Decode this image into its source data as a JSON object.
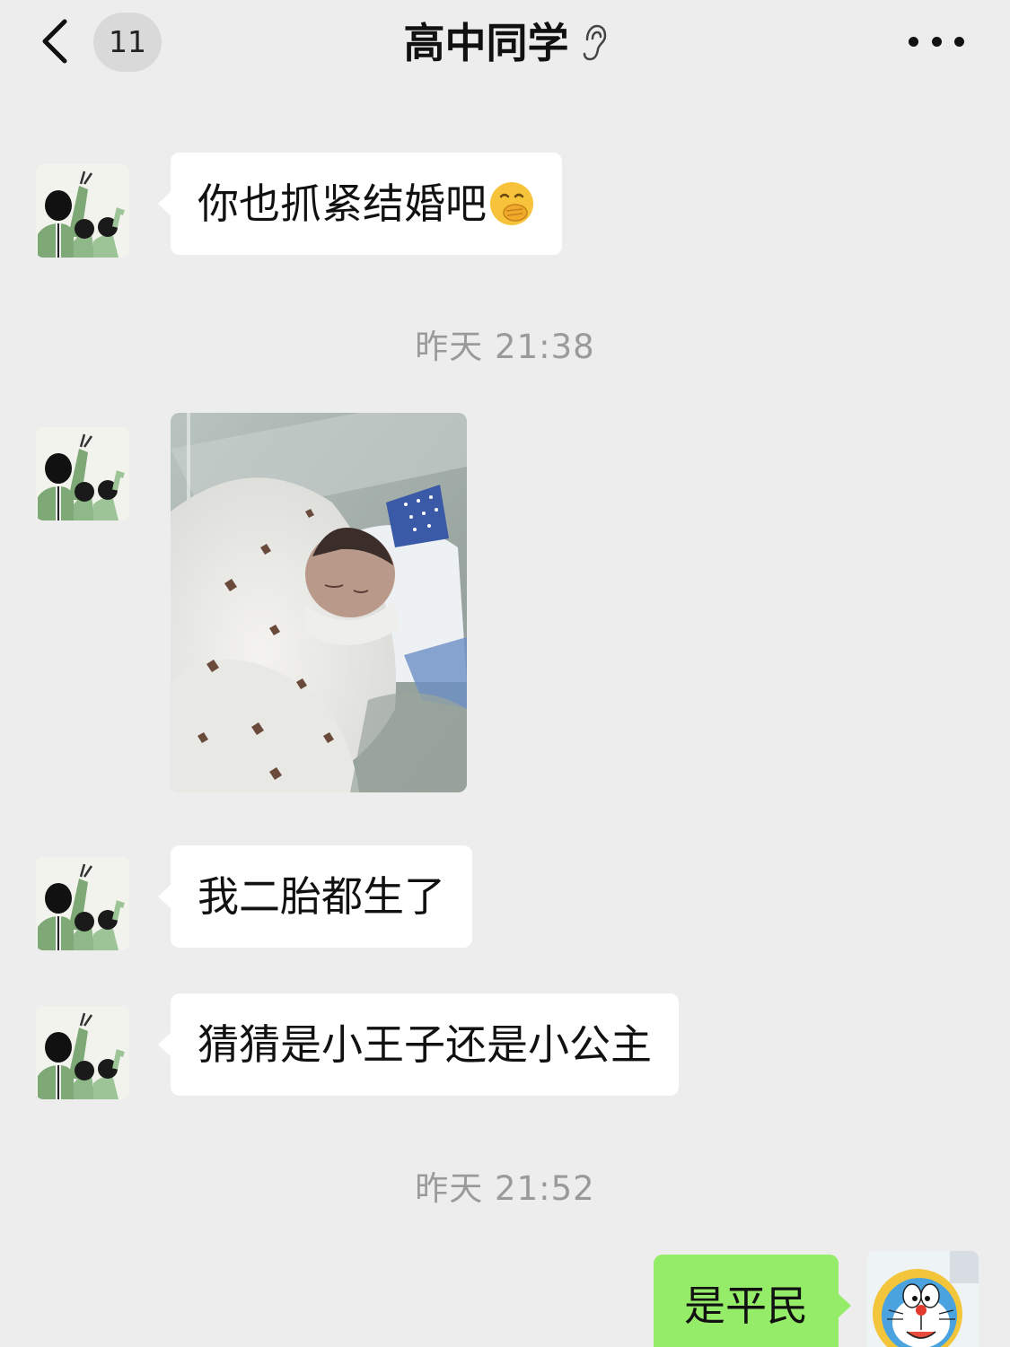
{
  "header": {
    "back_label": "",
    "unread_count": "11",
    "title": "高中同学",
    "title_icon": "ear-icon",
    "more_icon": "more-icon"
  },
  "messages": [
    {
      "sender": "friend",
      "type": "text",
      "text": "你也抓紧结婚吧",
      "emoji": "covering-mouth-emoji"
    },
    {
      "type": "timestamp",
      "text": "昨天 21:38"
    },
    {
      "sender": "friend",
      "type": "image",
      "image_subject": "newborn-baby-photo"
    },
    {
      "sender": "friend",
      "type": "text",
      "text": "我二胎都生了"
    },
    {
      "sender": "friend",
      "type": "text",
      "text": "猜猜是小王子还是小公主"
    },
    {
      "type": "timestamp",
      "text": "昨天 21:52"
    },
    {
      "sender": "me",
      "type": "text",
      "text": "是平民"
    }
  ],
  "colors": {
    "background": "#ededed",
    "bubble_other": "#ffffff",
    "bubble_self": "#95ec69",
    "timestamp_text": "#9a9a9a"
  }
}
